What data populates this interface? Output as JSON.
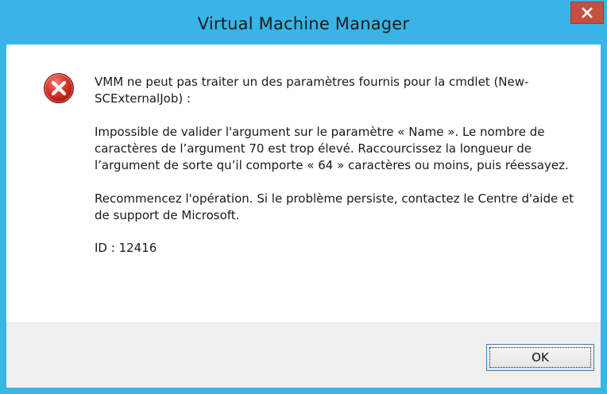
{
  "window": {
    "title": "Virtual Machine Manager",
    "close_icon": "close-icon",
    "close_color": "#c74f42",
    "frame_color": "#39b5e6"
  },
  "message": {
    "icon": "error-icon",
    "icon_color": "#d32f2f",
    "lead": "VMM ne peut pas traiter un des paramètres fournis pour la cmdlet (New-SCExternalJob) :",
    "detail": "Impossible de valider l'argument sur le paramètre « Name ». Le nombre de caractères de l’argument 70 est trop élevé. Raccourcissez la longueur de l’argument de sorte qu’il comporte « 64 » caractères ou moins, puis réessayez.",
    "action": "Recommencez l'opération. Si le problème persiste, contactez le Centre d'aide et de support de Microsoft.",
    "id_text": "ID : 12416"
  },
  "buttons": {
    "ok_label": "OK"
  }
}
